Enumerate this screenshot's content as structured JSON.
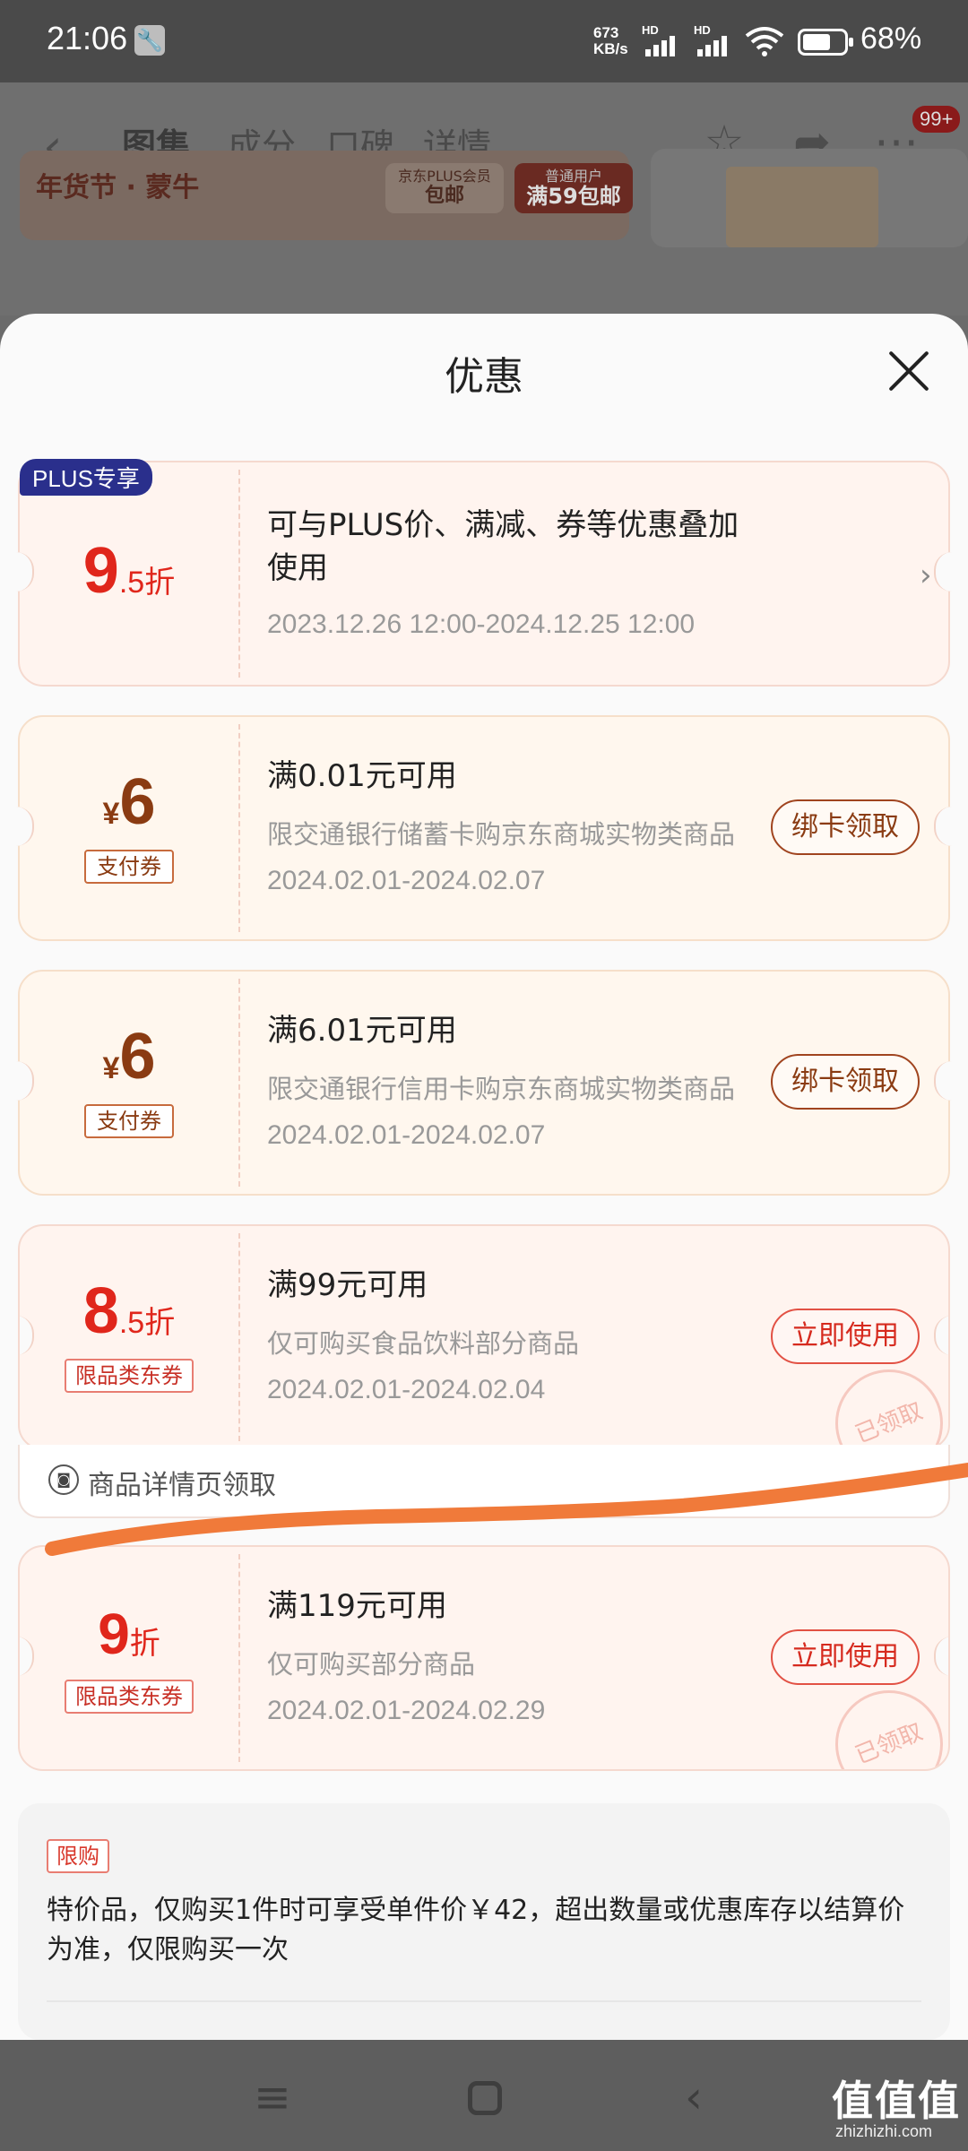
{
  "status_bar": {
    "time": "21:06",
    "net_speed_value": "673",
    "net_speed_unit": "KB/s",
    "hd1": "HD",
    "hd2": "HD",
    "battery_percent": "68%",
    "battery_level": 0.68
  },
  "background_page": {
    "tabs": [
      "图集",
      "成分",
      "口碑",
      "详情"
    ],
    "active_tab": "图集",
    "badge": "99+",
    "banner_left": "年货节 · 蒙牛",
    "banner_plus_top": "京东PLUS会员",
    "banner_plus_bottom": "包邮",
    "banner_normal_top": "普通用户",
    "banner_normal_bottom": "满59包邮"
  },
  "sheet": {
    "title": "优惠",
    "coupons": [
      {
        "badge": "PLUS专享",
        "amount_big": "9",
        "amount_small": ".5折",
        "line1": "可与PLUS价、满减、券等优惠叠加",
        "line1b": "使用",
        "dates": "2023.12.26 12:00-2024.12.25 12:00"
      },
      {
        "currency": "¥",
        "amount_big": "6",
        "tag": "支付券",
        "line1": "满0.01元可用",
        "line2": "限交通银行储蓄卡购京东商城实物类商品",
        "dates": "2024.02.01-2024.02.07",
        "button": "绑卡领取"
      },
      {
        "currency": "¥",
        "amount_big": "6",
        "tag": "支付券",
        "line1": "满6.01元可用",
        "line2": "限交通银行信用卡购京东商城实物类商品",
        "dates": "2024.02.01-2024.02.07",
        "button": "绑卡领取"
      },
      {
        "amount_big": "8",
        "amount_small": ".5折",
        "tag": "限品类东券",
        "line1": "满99元可用",
        "line2": "仅可购买食品饮料部分商品",
        "dates": "2024.02.01-2024.02.04",
        "button": "立即使用",
        "stamp": "已领取",
        "footer": "商品详情页领取"
      },
      {
        "amount_big": "9",
        "amount_small": "折",
        "tag": "限品类东券",
        "line1": "满119元可用",
        "line2": "仅可购买部分商品",
        "dates": "2024.02.01-2024.02.29",
        "button": "立即使用",
        "stamp": "已领取"
      }
    ],
    "notice": {
      "tag": "限购",
      "text": "特价品，仅购买1件时可享受单件价￥42，超出数量或优惠库存以结算价为准，仅限购买一次"
    }
  },
  "watermark": {
    "main": "值值值",
    "sub": "zhizhizhi.com"
  },
  "colors": {
    "accent_red": "#e0261b",
    "brown": "#8a3b12",
    "plus_blue": "#2a2f8c",
    "annotation_orange": "#f07a3a"
  }
}
